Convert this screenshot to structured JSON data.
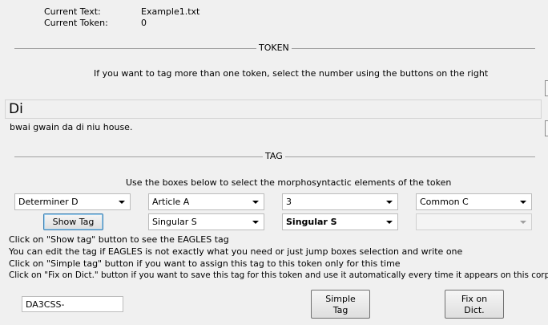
{
  "header": {
    "current_text_label": "Current Text:",
    "current_text_value": "Example1.txt",
    "current_token_label": "Current Token:",
    "current_token_value": "0"
  },
  "token_group": {
    "title": "TOKEN",
    "instruction": "If you want to tag more than one token, select the number using the buttons on the right",
    "token": "Di",
    "sentence": "bwai gwain da di niu house."
  },
  "tag_group": {
    "title": "TAG",
    "instruction": "Use the boxes below to select the morphosyntactic elements of the token",
    "combos_row1": [
      "Determiner D",
      "Article A",
      "3",
      "Common C"
    ],
    "combos_row2": [
      "Singular S",
      "Singular S",
      ""
    ],
    "show_tag_label": "Show Tag",
    "help_lines": [
      "Click on \"Show tag\" button to see the EAGLES tag",
      "You can edit the tag if EAGLES is not exactly what you need or just jump boxes selection and write one",
      "Click on \"Simple tag\" button if you want to assign this tag to this token only for this time",
      "Click on \"Fix on Dict.\" button if you want to save this tag for this token and use it automatically every time it appears on this corpus"
    ],
    "tag_value": "DA3CSS-",
    "simple_tag_label": [
      "Simple",
      "Tag"
    ],
    "fix_dict_label": [
      "Fix on",
      "Dict."
    ]
  }
}
